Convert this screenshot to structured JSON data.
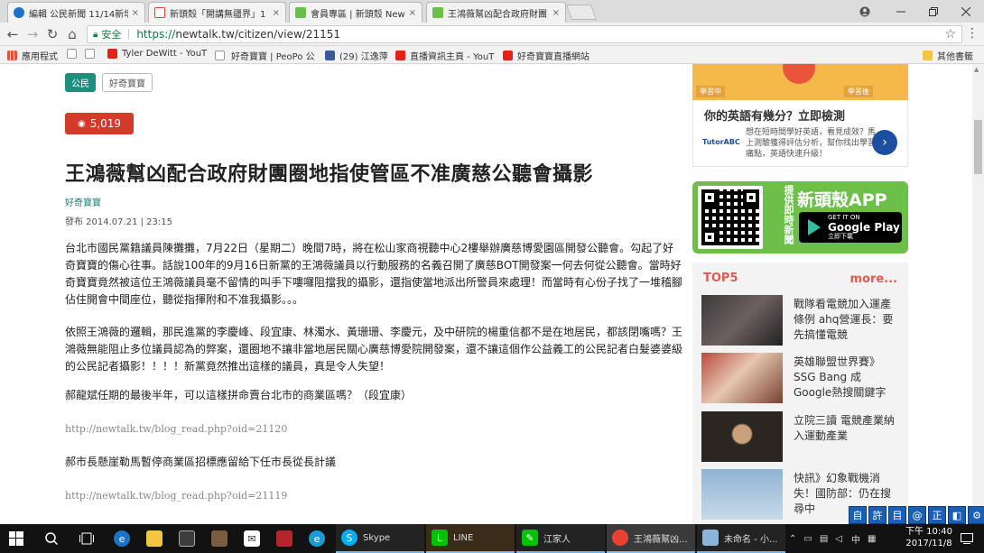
{
  "browser": {
    "tabs": [
      {
        "title": "編輯 公民新聞 11/14新增",
        "favicon_color": "#1b73c9",
        "active": false
      },
      {
        "title": "新頭殼「開講無疆界」1",
        "favicon_color": "#db4437",
        "active": false
      },
      {
        "title": "會員專區 | 新頭殼 Newtalk",
        "favicon_color": "#6cc04a",
        "active": false
      },
      {
        "title": "王鴻薇幫凶配合政府財團",
        "favicon_color": "#6cc04a",
        "active": true
      }
    ],
    "close_glyph": "×",
    "address": {
      "secure_label": "安全",
      "scheme": "https://",
      "url_rest": "newtalk.tw/citizen/view/21151"
    },
    "bookmarks": [
      {
        "label": "應用程式",
        "color": "#e0533d"
      },
      {
        "label": "",
        "color": "#cccccc"
      },
      {
        "label": "Tyler DeWitt - YouT",
        "color": "#e62117"
      },
      {
        "label": "",
        "color": "#cccccc"
      },
      {
        "label": "好奇寶寶 | PeoPo 公",
        "color": "#f0a030"
      },
      {
        "label": "(29) 江逸萍",
        "color": "#3b5998"
      },
      {
        "label": "直播資訊主頁 - YouT",
        "color": "#e62117"
      },
      {
        "label": "好奇寶寶直播網站",
        "color": "#e62117"
      }
    ],
    "other_bookmarks": "其他書籤"
  },
  "article": {
    "tags": [
      "公民",
      "好奇寶寶"
    ],
    "views": "5,019",
    "title": "王鴻薇幫凶配合政府財團圈地指使管區不准廣慈公聽會攝影",
    "author": "好奇寶寶",
    "published": "發布 2014.07.21 | 23:15",
    "paragraphs": [
      "台北市國民黨籍議員陳攤攤，7月22日（星期二）晚間7時，將在松山家商視聽中心2樓舉辦廣慈博愛園區開發公聽會。勾起了好奇寶寶的傷心往事。話說100年的9月16日新黨的王鴻薇議員以行動服務的名義召開了廣慈BOT開發案一何去何從公聽會。當時好奇寶寶竟然被這位王鴻薇議員毫不留情的叫手下嘍囉阻擋我的攝影，還指使當地派出所警員來處理！而當時有心份子找了一堆稽腳佔住開會中間座位，聽從指揮附和不准我攝影。。。",
      "依照王鴻薇的邏輯，那民進黨的李慶峰、段宜康、林濁水、黃珊珊、李慶元，及中研院的楊重信都不是在地居民，都該閉嘴嗎？王鴻薇無能阻止多位議員認為的弊案，還圈地不讓非當地居民關心廣慈博愛院開發案，還不讓這個作公益義工的公民記者白髮婆婆級的公民記者攝影！！！！新黨竟然推出這樣的議員，真是令人失望！",
      "郝龍斌任期的最後半年，可以這樣拼命賣台北市的商業區嗎？（段宜康）",
      "郝市長懸崖勒馬暫停商業區招標應留給下任市長從長計議"
    ],
    "links": [
      "http://newtalk.tw/blog_read.php?oid=21120",
      "http://newtalk.tw/blog_read.php?oid=21119"
    ]
  },
  "sidebar": {
    "ad_top_labels": [
      "學習中",
      "學習後"
    ],
    "ad": {
      "title": "你的英語有幾分？立即檢測",
      "brand": "TutorABC",
      "text": "想在短時間學好英語，看見成效？馬上測驗獲得評估分析，幫你找出學習痛點，英語快速升級！",
      "arrow": "›"
    },
    "app": {
      "vertical": "提供即時新聞",
      "name": "新頭殼APP",
      "store_small": "GET IT ON",
      "store": "Google Play",
      "store_sub": "立即下載"
    },
    "top5": {
      "heading": "TOP5",
      "more": "more...",
      "items": [
        "戰隊看電競加入運產條例 ahq營運長：要先搞懂電競",
        "英雄聯盟世界賽》SSG Bang 成Google熱搜關鍵字",
        "立院三讀 電競產業納入運動產業",
        "快訊》幻象戰機消失！國防部：仍在搜尋中"
      ]
    }
  },
  "ime_bar": [
    "自",
    "許",
    "目",
    "@",
    "正",
    "◧",
    "⚙"
  ],
  "taskbar": {
    "apps": [
      "Skype",
      "LINE",
      "江家人",
      "王鴻薇幫凶...",
      "未命名 - 小..."
    ],
    "ime_lang": "中",
    "time": "下午 10:40",
    "date": "2017/11/8"
  }
}
